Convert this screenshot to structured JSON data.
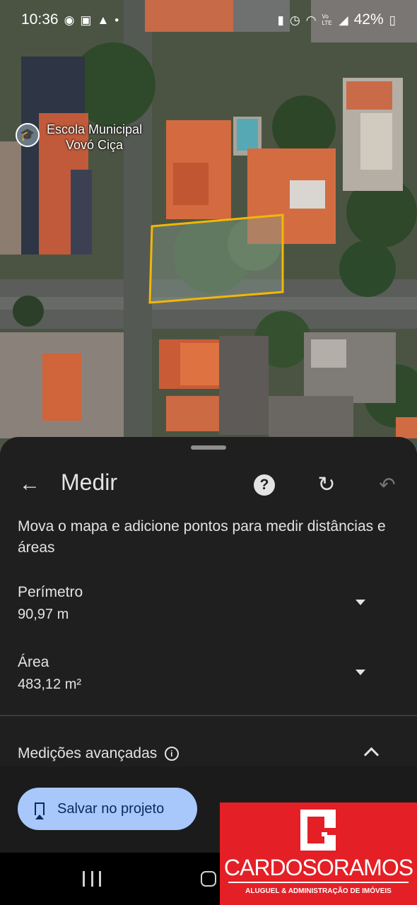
{
  "status_bar": {
    "time": "10:36",
    "left_icons": [
      "whatsapp-icon",
      "gallery-icon",
      "warning-icon",
      "dot-icon"
    ],
    "right_icons": [
      "battery-saver-icon",
      "alarm-icon",
      "wifi-icon",
      "volte-icon",
      "signal-icon"
    ],
    "volte_label": "Vo LTE",
    "battery": "42%"
  },
  "map": {
    "place_label": "Escola Municipal Vovó Ciça",
    "place_label_line1": "Escola Municipal",
    "place_label_line2": "Vovó Ciça",
    "place_icon": "school-icon",
    "polygon_color": "#f2b705"
  },
  "measure_panel": {
    "title": "Medir",
    "help_icon": "?",
    "instructions": "Mova o mapa e adicione pontos para medir distâncias e áreas",
    "perimeter": {
      "label": "Perímetro",
      "value": "90,97 m"
    },
    "area": {
      "label": "Área",
      "value": "483,12 m²"
    },
    "advanced": {
      "label": "Medições avançadas",
      "info_icon": "i"
    },
    "save_button": "Salvar no projeto",
    "accent_color": "#a8c7fa"
  },
  "watermark": {
    "brand": "CARDOSORAMOS",
    "tagline": "ALUGUEL & ADMINISTRAÇÃO DE IMÓVEIS",
    "color": "#e41f26"
  }
}
